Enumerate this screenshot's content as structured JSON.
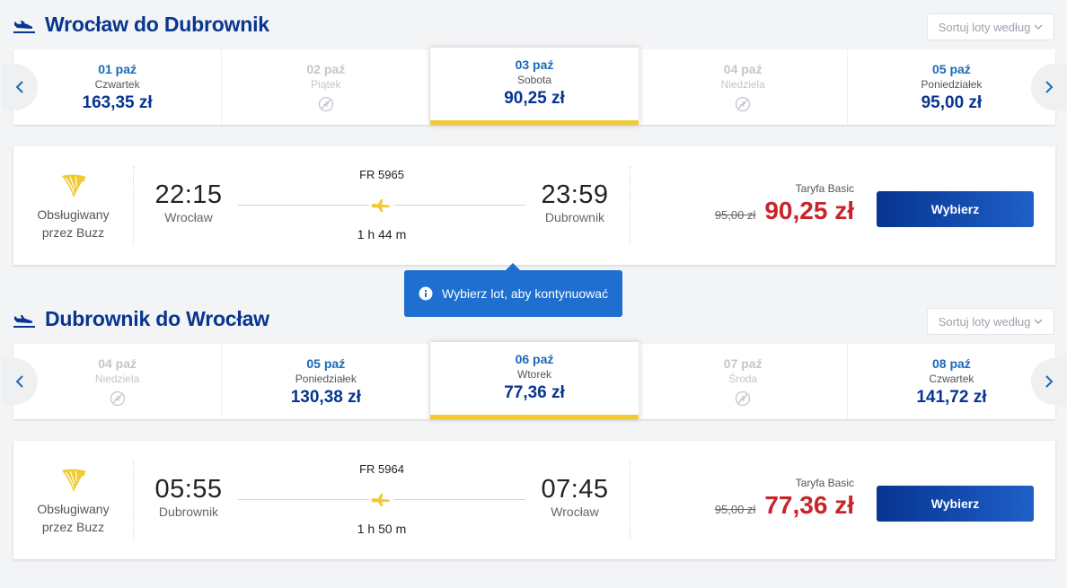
{
  "outbound": {
    "title": "Wrocław do Dubrownik",
    "sort_label": "Sortuj loty według",
    "dates": [
      {
        "date": "01 paź",
        "day": "Czwartek",
        "price": "163,35 zł",
        "available": true,
        "selected": false
      },
      {
        "date": "02 paź",
        "day": "Piątek",
        "price": "",
        "available": false,
        "selected": false
      },
      {
        "date": "03 paź",
        "day": "Sobota",
        "price": "90,25 zł",
        "available": true,
        "selected": true
      },
      {
        "date": "04 paź",
        "day": "Niedziela",
        "price": "",
        "available": false,
        "selected": false
      },
      {
        "date": "05 paź",
        "day": "Poniedziałek",
        "price": "95,00 zł",
        "available": true,
        "selected": false
      }
    ],
    "flight": {
      "operator": "Obsługiwany przez Buzz",
      "dep_time": "22:15",
      "dep_city": "Wrocław",
      "flight_number": "FR 5965",
      "duration": "1 h 44 m",
      "arr_time": "23:59",
      "arr_city": "Dubrownik",
      "fare_name": "Taryfa Basic",
      "old_price": "95,00 zł",
      "price": "90,25 zł",
      "button": "Wybierz"
    }
  },
  "tooltip": {
    "text": "Wybierz lot, aby kontynuować"
  },
  "inbound": {
    "title": "Dubrownik do Wrocław",
    "sort_label": "Sortuj loty według",
    "dates": [
      {
        "date": "04 paź",
        "day": "Niedziela",
        "price": "",
        "available": false,
        "selected": false
      },
      {
        "date": "05 paź",
        "day": "Poniedziałek",
        "price": "130,38 zł",
        "available": true,
        "selected": false
      },
      {
        "date": "06 paź",
        "day": "Wtorek",
        "price": "77,36 zł",
        "available": true,
        "selected": true
      },
      {
        "date": "07 paź",
        "day": "Środa",
        "price": "",
        "available": false,
        "selected": false
      },
      {
        "date": "08 paź",
        "day": "Czwartek",
        "price": "141,72 zł",
        "available": true,
        "selected": false
      }
    ],
    "flight": {
      "operator": "Obsługiwany przez Buzz",
      "dep_time": "05:55",
      "dep_city": "Dubrownik",
      "flight_number": "FR 5964",
      "duration": "1 h 50 m",
      "arr_time": "07:45",
      "arr_city": "Wrocław",
      "fare_name": "Taryfa Basic",
      "old_price": "95,00 zł",
      "price": "77,36 zł",
      "button": "Wybierz"
    }
  },
  "colors": {
    "brand_blue": "#073590",
    "accent_yellow": "#f1c933",
    "price_red": "#c8252b",
    "tooltip_blue": "#1e6fd0"
  },
  "icons": {
    "section": "plane-takeoff-icon",
    "no_flight": "no-flight-icon",
    "operator": "harp-logo-icon",
    "info": "info-icon"
  }
}
